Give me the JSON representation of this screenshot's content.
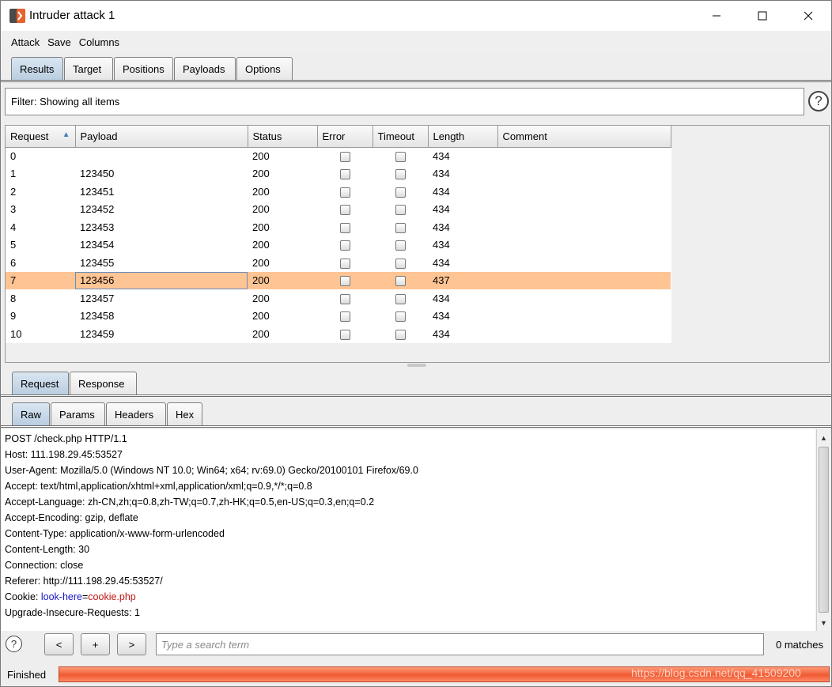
{
  "window": {
    "title": "Intruder attack 1"
  },
  "menu": {
    "items": [
      "Attack",
      "Save",
      "Columns"
    ]
  },
  "main_tabs": [
    {
      "label": "Results",
      "active": true
    },
    {
      "label": "Target",
      "active": false
    },
    {
      "label": "Positions",
      "active": false
    },
    {
      "label": "Payloads",
      "active": false
    },
    {
      "label": "Options",
      "active": false
    }
  ],
  "filter": {
    "text": "Filter: Showing all items"
  },
  "results_table": {
    "columns": [
      "Request",
      "Payload",
      "Status",
      "Error",
      "Timeout",
      "Length",
      "Comment"
    ],
    "sort_column": "Request",
    "rows": [
      {
        "request": "0",
        "payload": "",
        "status": "200",
        "error": false,
        "timeout": false,
        "length": "434",
        "comment": ""
      },
      {
        "request": "1",
        "payload": "123450",
        "status": "200",
        "error": false,
        "timeout": false,
        "length": "434",
        "comment": ""
      },
      {
        "request": "2",
        "payload": "123451",
        "status": "200",
        "error": false,
        "timeout": false,
        "length": "434",
        "comment": ""
      },
      {
        "request": "3",
        "payload": "123452",
        "status": "200",
        "error": false,
        "timeout": false,
        "length": "434",
        "comment": ""
      },
      {
        "request": "4",
        "payload": "123453",
        "status": "200",
        "error": false,
        "timeout": false,
        "length": "434",
        "comment": ""
      },
      {
        "request": "5",
        "payload": "123454",
        "status": "200",
        "error": false,
        "timeout": false,
        "length": "434",
        "comment": ""
      },
      {
        "request": "6",
        "payload": "123455",
        "status": "200",
        "error": false,
        "timeout": false,
        "length": "434",
        "comment": ""
      },
      {
        "request": "7",
        "payload": "123456",
        "status": "200",
        "error": false,
        "timeout": false,
        "length": "437",
        "comment": "",
        "selected": true
      },
      {
        "request": "8",
        "payload": "123457",
        "status": "200",
        "error": false,
        "timeout": false,
        "length": "434",
        "comment": ""
      },
      {
        "request": "9",
        "payload": "123458",
        "status": "200",
        "error": false,
        "timeout": false,
        "length": "434",
        "comment": ""
      },
      {
        "request": "10",
        "payload": "123459",
        "status": "200",
        "error": false,
        "timeout": false,
        "length": "434",
        "comment": ""
      }
    ]
  },
  "detail_tabs": [
    {
      "label": "Request",
      "active": true
    },
    {
      "label": "Response",
      "active": false
    }
  ],
  "view_tabs": [
    {
      "label": "Raw",
      "active": true
    },
    {
      "label": "Params",
      "active": false
    },
    {
      "label": "Headers",
      "active": false
    },
    {
      "label": "Hex",
      "active": false
    }
  ],
  "request_lines": [
    "POST /check.php HTTP/1.1",
    "Host: 111.198.29.45:53527",
    "User-Agent: Mozilla/5.0 (Windows NT 10.0; Win64; x64; rv:69.0) Gecko/20100101 Firefox/69.0",
    "Accept: text/html,application/xhtml+xml,application/xml;q=0.9,*/*;q=0.8",
    "Accept-Language: zh-CN,zh;q=0.8,zh-TW;q=0.7,zh-HK;q=0.5,en-US;q=0.3,en;q=0.2",
    "Accept-Encoding: gzip, deflate",
    "Content-Type: application/x-www-form-urlencoded",
    "Content-Length: 30",
    "Connection: close",
    "Referer: http://111.198.29.45:53527/"
  ],
  "cookie_line": {
    "prefix": "Cookie: ",
    "name": "look-here",
    "eq": "=",
    "value": "cookie.php"
  },
  "request_lines_after": [
    "Upgrade-Insecure-Requests: 1"
  ],
  "search": {
    "prev_label": "<",
    "add_label": "+",
    "next_label": ">",
    "placeholder": "Type a search term",
    "matches": "0 matches"
  },
  "status": {
    "label": "Finished",
    "progress": 1.0
  },
  "watermark": "https://blog.csdn.net/qq_41509200",
  "colors": {
    "selected_row": "#ffc494",
    "progress": "#f05a32",
    "cookie_name": "#1515c8",
    "cookie_value": "#c21515"
  }
}
